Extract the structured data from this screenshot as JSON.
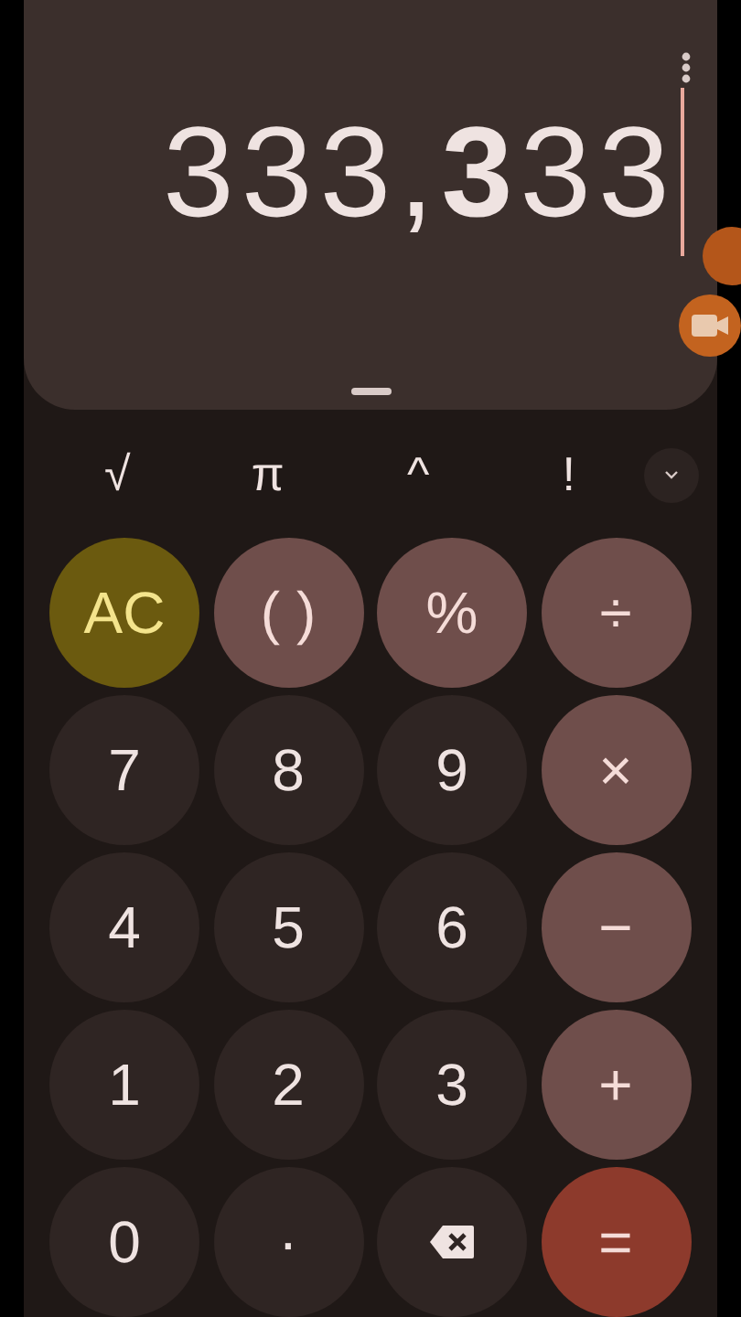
{
  "display": {
    "expression": "333,**3**33"
  },
  "scientific": [
    "√",
    "π",
    "^",
    "!"
  ],
  "keys": [
    {
      "label": "AC",
      "kind": "clear"
    },
    {
      "label": "( )",
      "kind": "func"
    },
    {
      "label": "%",
      "kind": "func"
    },
    {
      "label": "÷",
      "kind": "op"
    },
    {
      "label": "7",
      "kind": "digit"
    },
    {
      "label": "8",
      "kind": "digit"
    },
    {
      "label": "9",
      "kind": "digit"
    },
    {
      "label": "×",
      "kind": "op"
    },
    {
      "label": "4",
      "kind": "digit"
    },
    {
      "label": "5",
      "kind": "digit"
    },
    {
      "label": "6",
      "kind": "digit"
    },
    {
      "label": "−",
      "kind": "op"
    },
    {
      "label": "1",
      "kind": "digit"
    },
    {
      "label": "2",
      "kind": "digit"
    },
    {
      "label": "3",
      "kind": "digit"
    },
    {
      "label": "+",
      "kind": "op"
    },
    {
      "label": "0",
      "kind": "digit"
    },
    {
      "label": "·",
      "kind": "digit"
    },
    {
      "kind": "backspace"
    },
    {
      "label": "=",
      "kind": "equals"
    }
  ]
}
